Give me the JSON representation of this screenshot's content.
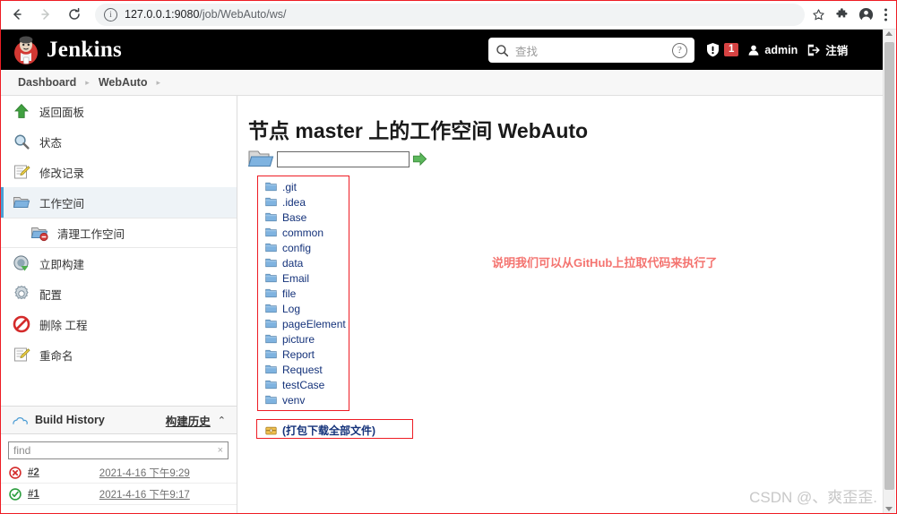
{
  "browser": {
    "url_host": "127.0.0.1:9080",
    "url_path": "/job/WebAuto/ws/",
    "back_icon": "back-arrow-icon",
    "forward_icon": "forward-arrow-icon",
    "reload_icon": "reload-icon",
    "site_info_icon": "site-info-icon",
    "bookmark_icon": "star-icon",
    "extensions_icon": "puzzle-icon",
    "profile_icon": "profile-avatar-icon",
    "menu_icon": "three-dot-menu-icon"
  },
  "header": {
    "brand": "Jenkins",
    "search_placeholder": "查找",
    "search_icon": "search-icon",
    "help_icon": "help-icon",
    "security_icon": "shield-warning-icon",
    "security_count": "1",
    "user_icon": "user-icon",
    "user_name": "admin",
    "logout_icon": "logout-icon",
    "logout_label": "注销"
  },
  "breadcrumb": {
    "items": [
      "Dashboard",
      "WebAuto"
    ],
    "separator": "▸"
  },
  "sidebar": {
    "items": [
      {
        "label": "返回面板",
        "icon": "up-arrow-icon",
        "active": false
      },
      {
        "label": "状态",
        "icon": "magnifier-icon",
        "active": false
      },
      {
        "label": "修改记录",
        "icon": "edit-document-icon",
        "active": false
      },
      {
        "label": "工作空间",
        "icon": "folder-open-icon",
        "active": true
      },
      {
        "label": "清理工作空间",
        "icon": "folder-delete-icon",
        "active": false
      },
      {
        "label": "立即构建",
        "icon": "build-now-icon",
        "active": false
      },
      {
        "label": "配置",
        "icon": "gear-icon",
        "active": false
      },
      {
        "label": "删除 工程",
        "icon": "delete-forbidden-icon",
        "active": false
      },
      {
        "label": "重命名",
        "icon": "rename-edit-icon",
        "active": false
      }
    ],
    "build_history": {
      "cloud_icon": "cloud-icon",
      "title": "Build History",
      "title_zh": "构建历史",
      "collapse_icon": "chevron-up-icon",
      "find_placeholder": "find",
      "find_clear_icon": "clear-x-icon",
      "builds": [
        {
          "number": "#2",
          "date": "2021-4-16 下午9:29",
          "status": "failed",
          "status_icon": "red-x-circle-icon"
        },
        {
          "number": "#1",
          "date": "2021-4-16 下午9:17",
          "status": "success",
          "status_icon": "green-check-circle-icon"
        }
      ]
    }
  },
  "main": {
    "title": "节点 master 上的工作空间 WebAuto",
    "path_folder_icon": "folder-open-icon",
    "path_value": "",
    "path_go_icon": "green-arrow-icon",
    "files": [
      {
        "name": ".git",
        "icon": "folder-icon"
      },
      {
        "name": ".idea",
        "icon": "folder-icon"
      },
      {
        "name": "Base",
        "icon": "folder-icon"
      },
      {
        "name": "common",
        "icon": "folder-icon"
      },
      {
        "name": "config",
        "icon": "folder-icon"
      },
      {
        "name": "data",
        "icon": "folder-icon"
      },
      {
        "name": "Email",
        "icon": "folder-icon"
      },
      {
        "name": "file",
        "icon": "folder-icon"
      },
      {
        "name": "Log",
        "icon": "folder-icon"
      },
      {
        "name": "pageElement",
        "icon": "folder-icon"
      },
      {
        "name": "picture",
        "icon": "folder-icon"
      },
      {
        "name": "Report",
        "icon": "folder-icon"
      },
      {
        "name": "Request",
        "icon": "folder-icon"
      },
      {
        "name": "testCase",
        "icon": "folder-icon"
      },
      {
        "name": "venv",
        "icon": "folder-icon"
      }
    ],
    "zip_icon": "archive-icon",
    "zip_label": "(打包下载全部文件)",
    "annotation": "说明我们可以从GitHub上拉取代码来执行了"
  },
  "watermark": "CSDN @、爽歪歪.",
  "colors": {
    "annotation_red": "#ee1c24",
    "annotation_text": "#f4736f",
    "jenkins_header_bg": "#000000",
    "active_sidebar_bg": "#eef3f7",
    "active_sidebar_accent": "#4b9fd5",
    "badge_red": "#d64242",
    "link_blue": "#14327a"
  }
}
